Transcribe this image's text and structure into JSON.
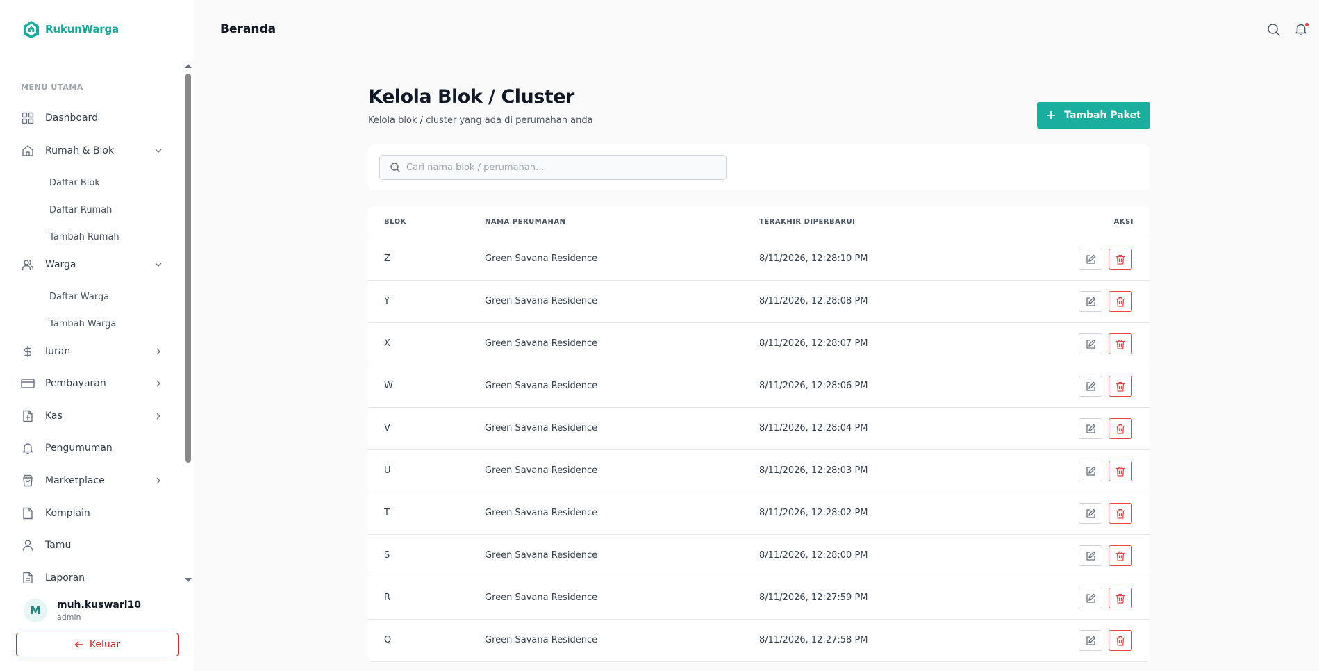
{
  "brand": {
    "name": "RukunWarga",
    "accent": "#1aae9f"
  },
  "sidebar": {
    "section_title": "MENU UTAMA",
    "items": {
      "dashboard": {
        "label": "Dashboard",
        "icon": "grid-icon"
      },
      "rumah": {
        "label": "Rumah & Blok",
        "icon": "home-icon",
        "expanded": true,
        "children": [
          "Daftar Blok",
          "Daftar Rumah",
          "Tambah Rumah"
        ]
      },
      "warga": {
        "label": "Warga",
        "icon": "users-icon",
        "expanded": true,
        "children": [
          "Daftar Warga",
          "Tambah Warga"
        ]
      },
      "iuran": {
        "label": "Iuran",
        "icon": "dollar-icon"
      },
      "pembayaran": {
        "label": "Pembayaran",
        "icon": "credit-card-icon"
      },
      "kas": {
        "label": "Kas",
        "icon": "file-plus-icon"
      },
      "pengumuman": {
        "label": "Pengumuman",
        "icon": "bell-icon"
      },
      "marketplace": {
        "label": "Marketplace",
        "icon": "shopping-bag-icon"
      },
      "komplain": {
        "label": "Komplain",
        "icon": "file-icon"
      },
      "tamu": {
        "label": "Tamu",
        "icon": "user-icon"
      },
      "laporan": {
        "label": "Laporan",
        "icon": "file-text-icon"
      }
    }
  },
  "user": {
    "initial": "M",
    "name": "muh.kuswari10",
    "role": "admin"
  },
  "logout_label": "Keluar",
  "header": {
    "title": "Beranda"
  },
  "main": {
    "title": "Kelola Blok / Cluster",
    "subtitle": "Kelola blok / cluster yang ada di perumahan anda",
    "add_button": "Tambah Paket",
    "search_placeholder": "Cari nama blok / perumahan...",
    "search_value": ""
  },
  "table": {
    "columns": {
      "blok": "BLOK",
      "nama": "NAMA PERUMAHAN",
      "updated": "TERAKHIR DIPERBARUI",
      "aksi": "AKSI"
    },
    "rows": [
      {
        "blok": "Z",
        "nama": "Green Savana Residence",
        "updated": "8/11/2026, 12:28:10 PM"
      },
      {
        "blok": "Y",
        "nama": "Green Savana Residence",
        "updated": "8/11/2026, 12:28:08 PM"
      },
      {
        "blok": "X",
        "nama": "Green Savana Residence",
        "updated": "8/11/2026, 12:28:07 PM"
      },
      {
        "blok": "W",
        "nama": "Green Savana Residence",
        "updated": "8/11/2026, 12:28:06 PM"
      },
      {
        "blok": "V",
        "nama": "Green Savana Residence",
        "updated": "8/11/2026, 12:28:04 PM"
      },
      {
        "blok": "U",
        "nama": "Green Savana Residence",
        "updated": "8/11/2026, 12:28:03 PM"
      },
      {
        "blok": "T",
        "nama": "Green Savana Residence",
        "updated": "8/11/2026, 12:28:02 PM"
      },
      {
        "blok": "S",
        "nama": "Green Savana Residence",
        "updated": "8/11/2026, 12:28:00 PM"
      },
      {
        "blok": "R",
        "nama": "Green Savana Residence",
        "updated": "8/11/2026, 12:27:59 PM"
      },
      {
        "blok": "Q",
        "nama": "Green Savana Residence",
        "updated": "8/11/2026, 12:27:58 PM"
      }
    ]
  }
}
